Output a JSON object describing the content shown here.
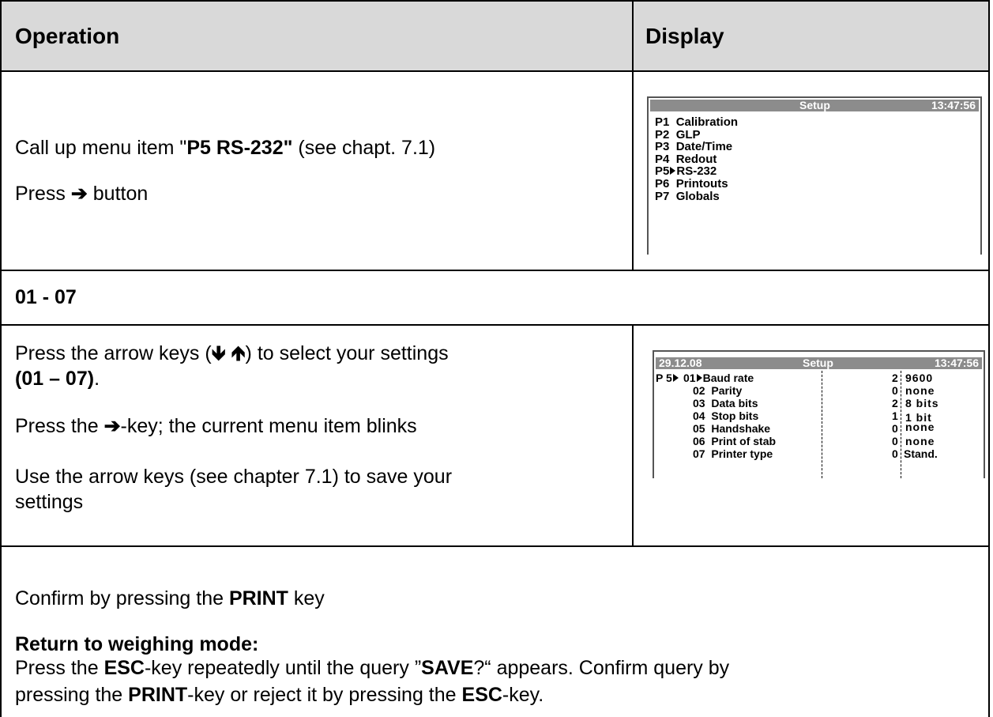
{
  "header": {
    "col1": "Operation",
    "col2": "Display"
  },
  "step1": {
    "line1_pre": "Call up menu item \"",
    "line1_bold": "P5 RS-232\"",
    "line1_post": " (see chapt. 7.1)",
    "line2_pre": "Press ",
    "line2_arrow": "➔",
    "line2_post": " button"
  },
  "display1": {
    "title": "Setup",
    "time": "13:47:56",
    "items": [
      {
        "code": "P1",
        "label": "Calibration"
      },
      {
        "code": "P2",
        "label": "GLP"
      },
      {
        "code": "P3",
        "label": "Date/Time"
      },
      {
        "code": "P4",
        "label": "Redout"
      },
      {
        "code": "P5",
        "label": "RS-232"
      },
      {
        "code": "P6",
        "label": "Printouts"
      },
      {
        "code": "P7",
        "label": "Globals"
      }
    ]
  },
  "section": {
    "title": "01 - 07"
  },
  "step2": {
    "p1_pre": "Press the arrow keys (",
    "p1_arrows": "🡻 🡹",
    "p1_post": ") to select your settings",
    "p1_bold": "(01 – 07)",
    "p1_end": ".",
    "p2_pre": "Press the ",
    "p2_arrow": "➔",
    "p2_post": "-key; the current menu item blinks",
    "p3_line1": "Use the arrow keys (see chapter 7.1) to save your",
    "p3_line2": "settings"
  },
  "display2": {
    "date": "29.12.08",
    "title": "Setup",
    "time": "13:47:56",
    "prefix": "P 5",
    "rows": [
      {
        "num": "01",
        "label": "Baud rate",
        "code": "2",
        "value": "9600"
      },
      {
        "num": "02",
        "label": "Parity",
        "code": "0",
        "value": "none"
      },
      {
        "num": "03",
        "label": "Data bits",
        "code": "2",
        "value": "8 bits"
      },
      {
        "num": "04",
        "label": "Stop bits",
        "code": "1",
        "value": "1 bit"
      },
      {
        "num": "05",
        "label": "Handshake",
        "code": "0",
        "value": "none"
      },
      {
        "num": "06",
        "label": "Print of stab",
        "code": "0",
        "value": "none"
      },
      {
        "num": "07",
        "label": "Printer type",
        "code": "0",
        "value": "Stand."
      }
    ]
  },
  "footer": {
    "confirm_pre": "Confirm by pressing the ",
    "confirm_bold": "PRINT",
    "confirm_post": " key",
    "return_title": "Return to weighing mode:",
    "l1_a": "Press the ",
    "l1_b": "ESC",
    "l1_c": "-key repeatedly until the query ”",
    "l1_d": "SAVE",
    "l1_e": "?“ appears. Confirm query by",
    "l2_a": "pressing the ",
    "l2_b": "PRINT",
    "l2_c": "-key or reject it by pressing the ",
    "l2_d": "ESC",
    "l2_e": "-key."
  }
}
